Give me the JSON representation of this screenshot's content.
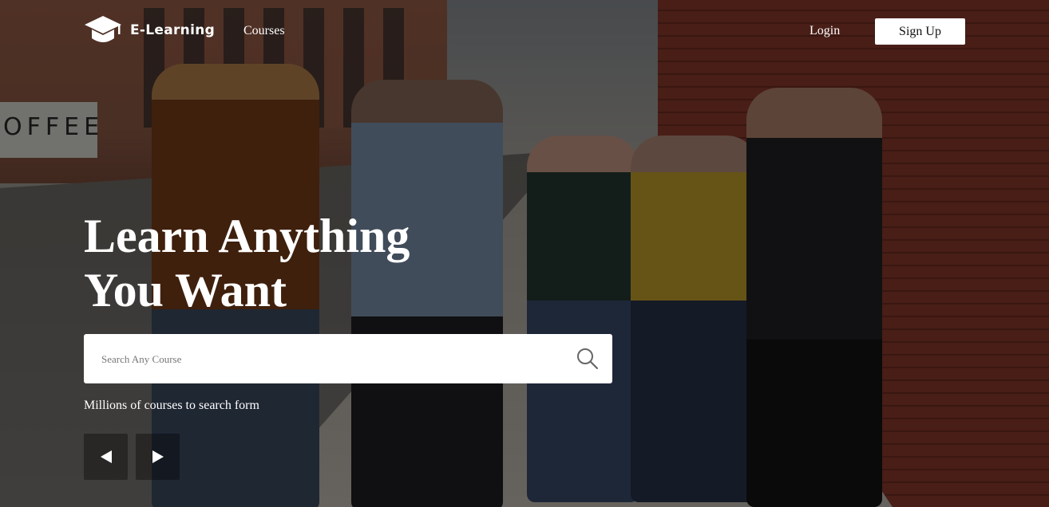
{
  "nav": {
    "brand": "E-Learning",
    "links": [
      {
        "label": "Courses"
      }
    ],
    "login_label": "Login",
    "signup_label": "Sign Up"
  },
  "hero": {
    "title_line1": "Learn Anything",
    "title_line2": "You Want",
    "search": {
      "placeholder": "Search Any Course",
      "value": ""
    },
    "tagline": "Millions of courses to search form",
    "prev_icon": "triangle-left-icon",
    "next_icon": "triangle-right-icon",
    "search_icon": "magnifier-icon",
    "logo_icon": "graduation-cap-icon"
  },
  "colors": {
    "text": "#ffffff",
    "overlay": "rgba(0,0,0,0.48)",
    "button_bg": "#ffffff",
    "button_text": "#111111"
  }
}
